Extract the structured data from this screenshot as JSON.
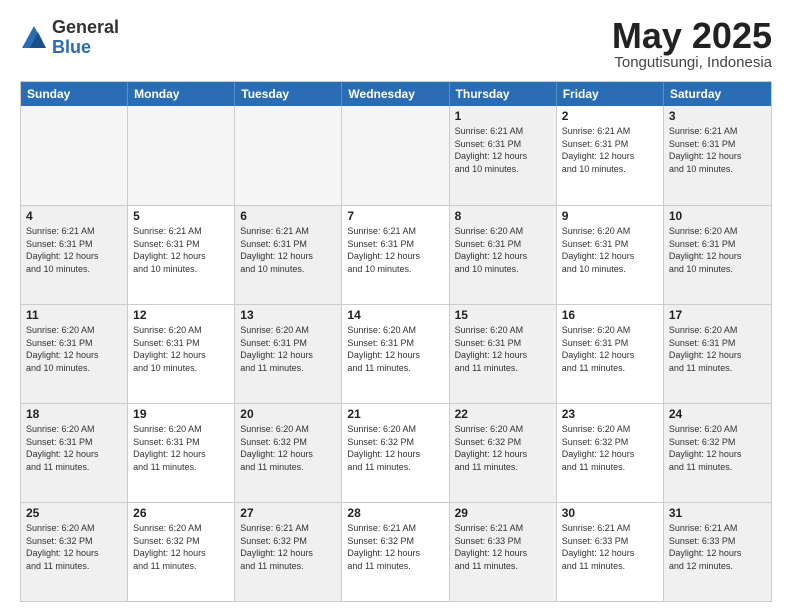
{
  "logo": {
    "general": "General",
    "blue": "Blue"
  },
  "title": "May 2025",
  "location": "Tongutisungi, Indonesia",
  "header_days": [
    "Sunday",
    "Monday",
    "Tuesday",
    "Wednesday",
    "Thursday",
    "Friday",
    "Saturday"
  ],
  "weeks": [
    [
      {
        "day": "",
        "info": "",
        "empty": true
      },
      {
        "day": "",
        "info": "",
        "empty": true
      },
      {
        "day": "",
        "info": "",
        "empty": true
      },
      {
        "day": "",
        "info": "",
        "empty": true
      },
      {
        "day": "1",
        "info": "Sunrise: 6:21 AM\nSunset: 6:31 PM\nDaylight: 12 hours\nand 10 minutes."
      },
      {
        "day": "2",
        "info": "Sunrise: 6:21 AM\nSunset: 6:31 PM\nDaylight: 12 hours\nand 10 minutes."
      },
      {
        "day": "3",
        "info": "Sunrise: 6:21 AM\nSunset: 6:31 PM\nDaylight: 12 hours\nand 10 minutes."
      }
    ],
    [
      {
        "day": "4",
        "info": "Sunrise: 6:21 AM\nSunset: 6:31 PM\nDaylight: 12 hours\nand 10 minutes."
      },
      {
        "day": "5",
        "info": "Sunrise: 6:21 AM\nSunset: 6:31 PM\nDaylight: 12 hours\nand 10 minutes."
      },
      {
        "day": "6",
        "info": "Sunrise: 6:21 AM\nSunset: 6:31 PM\nDaylight: 12 hours\nand 10 minutes."
      },
      {
        "day": "7",
        "info": "Sunrise: 6:21 AM\nSunset: 6:31 PM\nDaylight: 12 hours\nand 10 minutes."
      },
      {
        "day": "8",
        "info": "Sunrise: 6:20 AM\nSunset: 6:31 PM\nDaylight: 12 hours\nand 10 minutes."
      },
      {
        "day": "9",
        "info": "Sunrise: 6:20 AM\nSunset: 6:31 PM\nDaylight: 12 hours\nand 10 minutes."
      },
      {
        "day": "10",
        "info": "Sunrise: 6:20 AM\nSunset: 6:31 PM\nDaylight: 12 hours\nand 10 minutes."
      }
    ],
    [
      {
        "day": "11",
        "info": "Sunrise: 6:20 AM\nSunset: 6:31 PM\nDaylight: 12 hours\nand 10 minutes."
      },
      {
        "day": "12",
        "info": "Sunrise: 6:20 AM\nSunset: 6:31 PM\nDaylight: 12 hours\nand 10 minutes."
      },
      {
        "day": "13",
        "info": "Sunrise: 6:20 AM\nSunset: 6:31 PM\nDaylight: 12 hours\nand 11 minutes."
      },
      {
        "day": "14",
        "info": "Sunrise: 6:20 AM\nSunset: 6:31 PM\nDaylight: 12 hours\nand 11 minutes."
      },
      {
        "day": "15",
        "info": "Sunrise: 6:20 AM\nSunset: 6:31 PM\nDaylight: 12 hours\nand 11 minutes."
      },
      {
        "day": "16",
        "info": "Sunrise: 6:20 AM\nSunset: 6:31 PM\nDaylight: 12 hours\nand 11 minutes."
      },
      {
        "day": "17",
        "info": "Sunrise: 6:20 AM\nSunset: 6:31 PM\nDaylight: 12 hours\nand 11 minutes."
      }
    ],
    [
      {
        "day": "18",
        "info": "Sunrise: 6:20 AM\nSunset: 6:31 PM\nDaylight: 12 hours\nand 11 minutes."
      },
      {
        "day": "19",
        "info": "Sunrise: 6:20 AM\nSunset: 6:31 PM\nDaylight: 12 hours\nand 11 minutes."
      },
      {
        "day": "20",
        "info": "Sunrise: 6:20 AM\nSunset: 6:32 PM\nDaylight: 12 hours\nand 11 minutes."
      },
      {
        "day": "21",
        "info": "Sunrise: 6:20 AM\nSunset: 6:32 PM\nDaylight: 12 hours\nand 11 minutes."
      },
      {
        "day": "22",
        "info": "Sunrise: 6:20 AM\nSunset: 6:32 PM\nDaylight: 12 hours\nand 11 minutes."
      },
      {
        "day": "23",
        "info": "Sunrise: 6:20 AM\nSunset: 6:32 PM\nDaylight: 12 hours\nand 11 minutes."
      },
      {
        "day": "24",
        "info": "Sunrise: 6:20 AM\nSunset: 6:32 PM\nDaylight: 12 hours\nand 11 minutes."
      }
    ],
    [
      {
        "day": "25",
        "info": "Sunrise: 6:20 AM\nSunset: 6:32 PM\nDaylight: 12 hours\nand 11 minutes."
      },
      {
        "day": "26",
        "info": "Sunrise: 6:20 AM\nSunset: 6:32 PM\nDaylight: 12 hours\nand 11 minutes."
      },
      {
        "day": "27",
        "info": "Sunrise: 6:21 AM\nSunset: 6:32 PM\nDaylight: 12 hours\nand 11 minutes."
      },
      {
        "day": "28",
        "info": "Sunrise: 6:21 AM\nSunset: 6:32 PM\nDaylight: 12 hours\nand 11 minutes."
      },
      {
        "day": "29",
        "info": "Sunrise: 6:21 AM\nSunset: 6:33 PM\nDaylight: 12 hours\nand 11 minutes."
      },
      {
        "day": "30",
        "info": "Sunrise: 6:21 AM\nSunset: 6:33 PM\nDaylight: 12 hours\nand 11 minutes."
      },
      {
        "day": "31",
        "info": "Sunrise: 6:21 AM\nSunset: 6:33 PM\nDaylight: 12 hours\nand 12 minutes."
      }
    ]
  ]
}
